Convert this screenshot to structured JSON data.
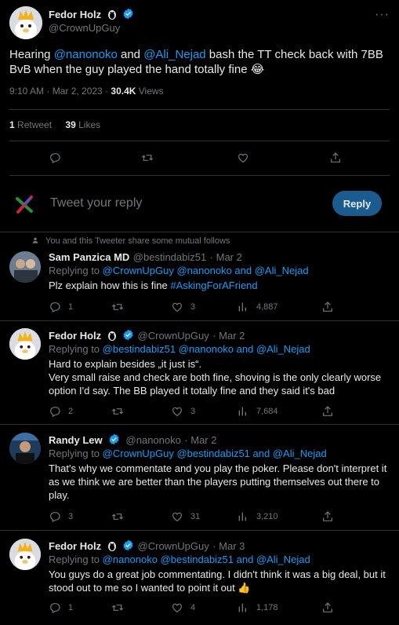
{
  "main_tweet": {
    "name": "Fedor Holz",
    "handle": "@CrownUpGuy",
    "text_pre": "Hearing ",
    "mention1": "@nanonoko",
    "text_and": " and ",
    "mention2": "@Ali_Nejad",
    "text_post": " bash the TT check back with 7BB BvB when the guy played the hand totally fine 😂",
    "time": "9:10 AM · Mar 2, 2023 · ",
    "views_count": "30.4K",
    "views_label": " Views",
    "retweets_count": "1",
    "retweets_label": "Retweet",
    "likes_count": "39",
    "likes_label": "Likes"
  },
  "composer": {
    "placeholder": "Tweet your reply",
    "reply_label": "Reply"
  },
  "replies": [
    {
      "context": "You and this Tweeter share some mutual follows",
      "name": "Sam Panzica MD",
      "handle": "@bestindabiz51",
      "date": "· Mar 2",
      "replying_label": "Replying to ",
      "replying_to": "@CrownUpGuy @nanonoko and @Ali_Nejad",
      "text": "Plz explain how this is fine ",
      "hashtag": "#AskingForAFriend",
      "replies": "1",
      "retweets": "",
      "likes": "3",
      "views": "4,887"
    },
    {
      "name": "Fedor Holz",
      "handle": "@CrownUpGuy",
      "date": "· Mar 2",
      "replying_label": "Replying to ",
      "replying_to": "@bestindabiz51 @nanonoko and @Ali_Nejad",
      "text_l1": "Hard to explain besides „it just is“.",
      "text_l2": "Very small raise and check are both fine, shoving is the only clearly worse option I'd say. The BB played it totally fine and they said it's bad",
      "replies": "2",
      "retweets": "",
      "likes": "3",
      "views": "7,684"
    },
    {
      "name": "Randy Lew",
      "handle": "@nanonoko",
      "date": "· Mar 2",
      "replying_label": "Replying to ",
      "replying_to": "@CrownUpGuy @bestindabiz51 and @Ali_Nejad",
      "text": "That's why we commentate and you play the poker. Please don't interpret it as we think we are better than the players putting themselves out there to play.",
      "replies": "3",
      "retweets": "",
      "likes": "31",
      "views": "3,210"
    },
    {
      "name": "Fedor Holz",
      "handle": "@CrownUpGuy",
      "date": "· Mar 3",
      "replying_label": "Replying to ",
      "replying_to": "@nanonoko @bestindabiz51 and @Ali_Nejad",
      "text": "You guys do a great job commentating. I didn't think it was a big deal, but it stood out to me so I wanted to point it out 👍",
      "replies": "1",
      "retweets": "",
      "likes": "4",
      "views": "1,178"
    }
  ],
  "colors": {
    "background": "#000000",
    "text": "#e7e9ea",
    "muted": "#71767b",
    "accent": "#1d9bf0",
    "reply_button": "#1a5c8f",
    "divider": "#2f3336"
  },
  "icons": [
    "more-icon",
    "verified-icon",
    "reply-icon",
    "retweet-icon",
    "like-icon",
    "share-icon",
    "views-icon",
    "person-icon"
  ]
}
